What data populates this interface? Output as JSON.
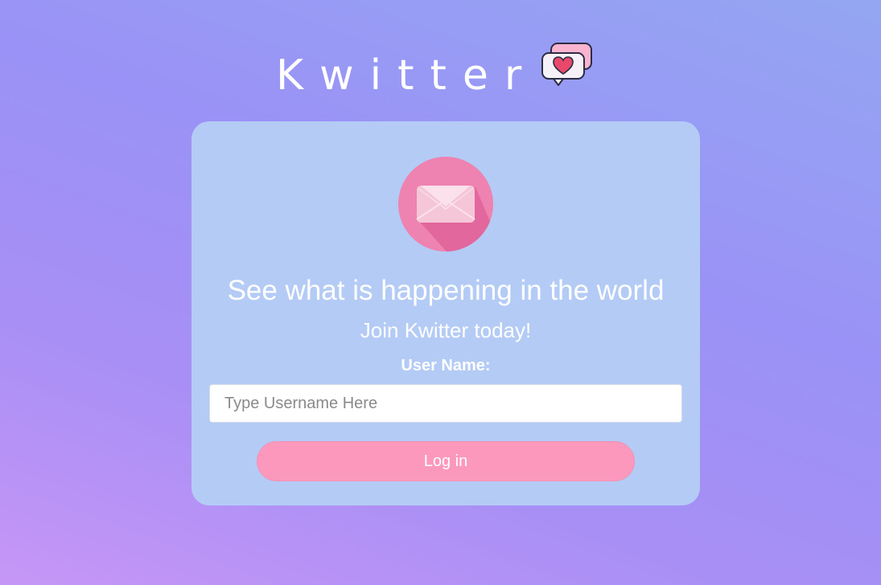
{
  "app": {
    "title": "Kwitter"
  },
  "header": {
    "logo_icon": "chat-bubbles-heart-icon"
  },
  "card": {
    "badge_icon": "mail-envelope-icon",
    "headline": "See what is happening in the world",
    "subheadline": "Join Kwitter today!"
  },
  "form": {
    "username_label": "User Name:",
    "username_placeholder": "Type Username Here",
    "username_value": "",
    "login_label": "Log in"
  },
  "colors": {
    "card_background": "#b3cbf5",
    "button_background": "#fd98bd",
    "badge_pink": "#ee82b1",
    "heart_red": "#e8496a"
  }
}
